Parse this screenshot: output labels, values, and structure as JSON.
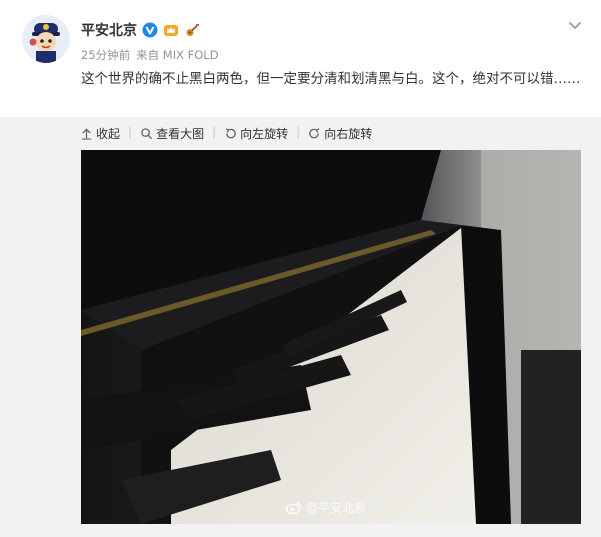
{
  "post": {
    "author": "平安北京",
    "time": "25分钟前",
    "source": "来自 MIX FOLD",
    "text": "这个世界的确不止黑白两色，但一定要分清和划清黑与白。这个，绝对不可以错……"
  },
  "toolbar": {
    "collapse": "收起",
    "view_large": "查看大图",
    "rotate_left": "向左旋转",
    "rotate_right": "向右旋转"
  },
  "image": {
    "watermark": "@平安北京"
  }
}
